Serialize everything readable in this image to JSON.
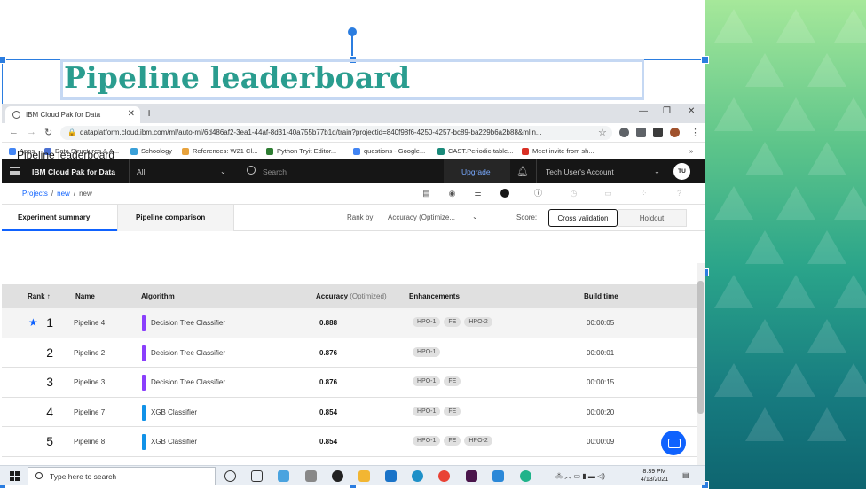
{
  "slide": {
    "title": "Pipeline leaderboard"
  },
  "browser": {
    "tab_title": "IBM Cloud Pak for Data",
    "url": "dataplatform.cloud.ibm.com/ml/auto-ml/6d486af2-3ea1-44af-8d31-40a755b77b1d/train?projectid=840f98f6-4250-4257-bc89-ba229b6a2b88&mlln...",
    "bookmarks": [
      "Apps",
      "Data Structures & A...",
      "Schoology",
      "References: W21 Cl...",
      "Python Tryit Editor...",
      "questions - Google...",
      "CAST.Periodic-table...",
      "Meet invite from sh..."
    ]
  },
  "ibm": {
    "brand": "IBM Cloud Pak for Data",
    "scope": "All",
    "search_placeholder": "Search",
    "upgrade": "Upgrade",
    "account": "Tech User's Account",
    "avatar": "TU"
  },
  "breadcrumb": {
    "projects": "Projects",
    "new1": "new",
    "new2": "new"
  },
  "tabs": {
    "experiment_summary": "Experiment summary",
    "pipeline_comparison": "Pipeline comparison"
  },
  "rank_by": {
    "label": "Rank by:",
    "value": "Accuracy (Optimize..."
  },
  "score": {
    "label": "Score:",
    "cross_validation": "Cross validation",
    "holdout": "Holdout"
  },
  "leaderboard": {
    "title": "Pipeline leaderboard",
    "columns": {
      "rank": "Rank ↑",
      "name": "Name",
      "algorithm": "Algorithm",
      "accuracy": "Accuracy",
      "accuracy_note": "(Optimized)",
      "enhancements": "Enhancements",
      "build_time": "Build time"
    },
    "rows": [
      {
        "rank": "1",
        "name": "Pipeline 4",
        "algorithm": "Decision Tree Classifier",
        "accuracy": "0.888",
        "enhancements": [
          "HPO-1",
          "FE",
          "HPO-2"
        ],
        "build_time": "00:00:05",
        "algo_color": "#8a3ffc"
      },
      {
        "rank": "2",
        "name": "Pipeline 2",
        "algorithm": "Decision Tree Classifier",
        "accuracy": "0.876",
        "enhancements": [
          "HPO-1"
        ],
        "build_time": "00:00:01",
        "algo_color": "#8a3ffc"
      },
      {
        "rank": "3",
        "name": "Pipeline 3",
        "algorithm": "Decision Tree Classifier",
        "accuracy": "0.876",
        "enhancements": [
          "HPO-1",
          "FE"
        ],
        "build_time": "00:00:15",
        "algo_color": "#8a3ffc"
      },
      {
        "rank": "4",
        "name": "Pipeline 7",
        "algorithm": "XGB Classifier",
        "accuracy": "0.854",
        "enhancements": [
          "HPO-1",
          "FE"
        ],
        "build_time": "00:00:20",
        "algo_color": "#1192e8"
      },
      {
        "rank": "5",
        "name": "Pipeline 8",
        "algorithm": "XGB Classifier",
        "accuracy": "0.854",
        "enhancements": [
          "HPO-1",
          "FE",
          "HPO-2"
        ],
        "build_time": "00:00:09",
        "algo_color": "#1192e8"
      }
    ]
  },
  "taskbar": {
    "search_placeholder": "Type here to search",
    "time": "8:39 PM",
    "date": "4/13/2021"
  }
}
